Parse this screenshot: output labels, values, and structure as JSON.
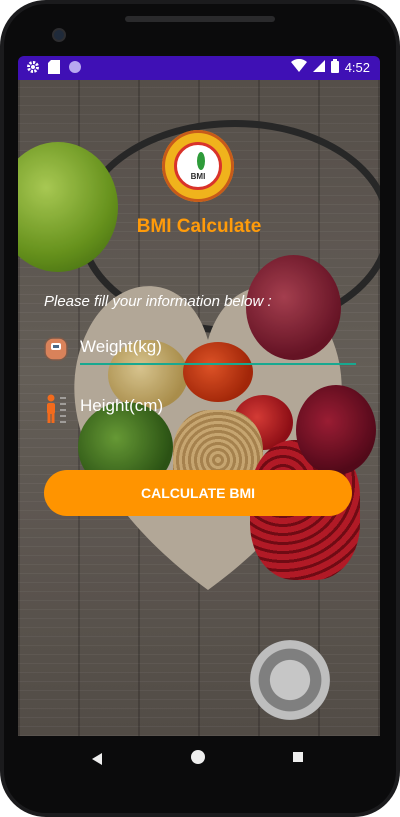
{
  "status_bar": {
    "time": "4:52",
    "left_icons": [
      "gear-icon",
      "sd-card-icon",
      "record-icon"
    ],
    "right_icons": [
      "wifi-icon",
      "signal-icon",
      "battery-icon"
    ],
    "bg_color": "#3f10b5"
  },
  "app": {
    "logo_text": "BMI",
    "title": "BMI Calculate",
    "prompt": "Please fill your information below :",
    "weight_placeholder": "Weight(kg)",
    "height_placeholder": "Height(cm)",
    "calculate_label": "CALCULATE BMI",
    "accent_color": "#ff9400",
    "focus_line_color": "#18a890"
  },
  "nav_bar": {
    "buttons": [
      "back-icon",
      "home-icon",
      "recents-icon"
    ]
  }
}
